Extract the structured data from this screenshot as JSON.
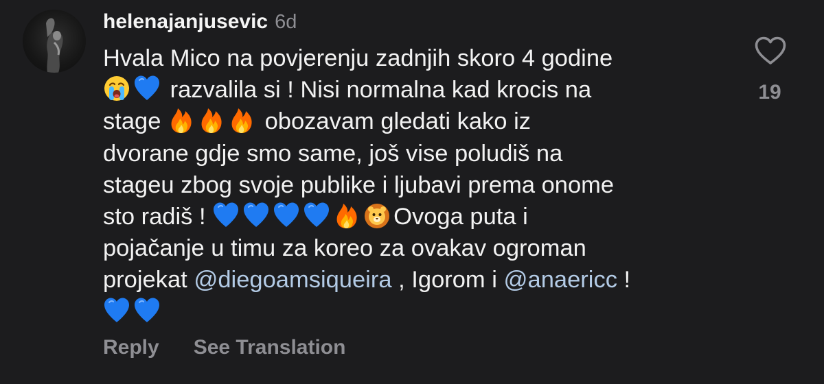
{
  "comment": {
    "username": "helenajanjusevic",
    "timestamp": "6d",
    "lines": [
      [
        "Hvala Mico na povjerenju zadnjih skoro 4 godine"
      ],
      [
        "razvalila si ! Nisi normalna kad krocis na"
      ],
      [
        "stage",
        "obozavam gledati kako iz"
      ],
      [
        "dvorane gdje smo same, još vise poludiš na"
      ],
      [
        "stageu zbog svoje publike i ljubavi prema onome"
      ],
      [
        "sto radiš !",
        "Ovoga puta i"
      ],
      [
        "pojačanje u timu za koreo za ovakav ogroman"
      ],
      [
        "projekat",
        "@diegoamsiqueira",
        ", Igorom i",
        "@anaericc",
        "!"
      ]
    ],
    "emojis": {
      "crying": "crying-face-emoji",
      "blue_heart": "blue-heart-emoji",
      "fire": "fire-emoji",
      "lion": "lion-face-emoji"
    },
    "colors": {
      "background": "#1c1c1e",
      "text": "#f2f2f2",
      "secondary": "#8e8e93",
      "mention": "#b3cbe6",
      "blue_heart": "#1f7bf2",
      "fire": "#ff7a00"
    }
  },
  "likes": {
    "count": "19",
    "icon": "heart-outline-icon"
  },
  "actions": {
    "reply_label": "Reply",
    "translate_label": "See Translation"
  }
}
